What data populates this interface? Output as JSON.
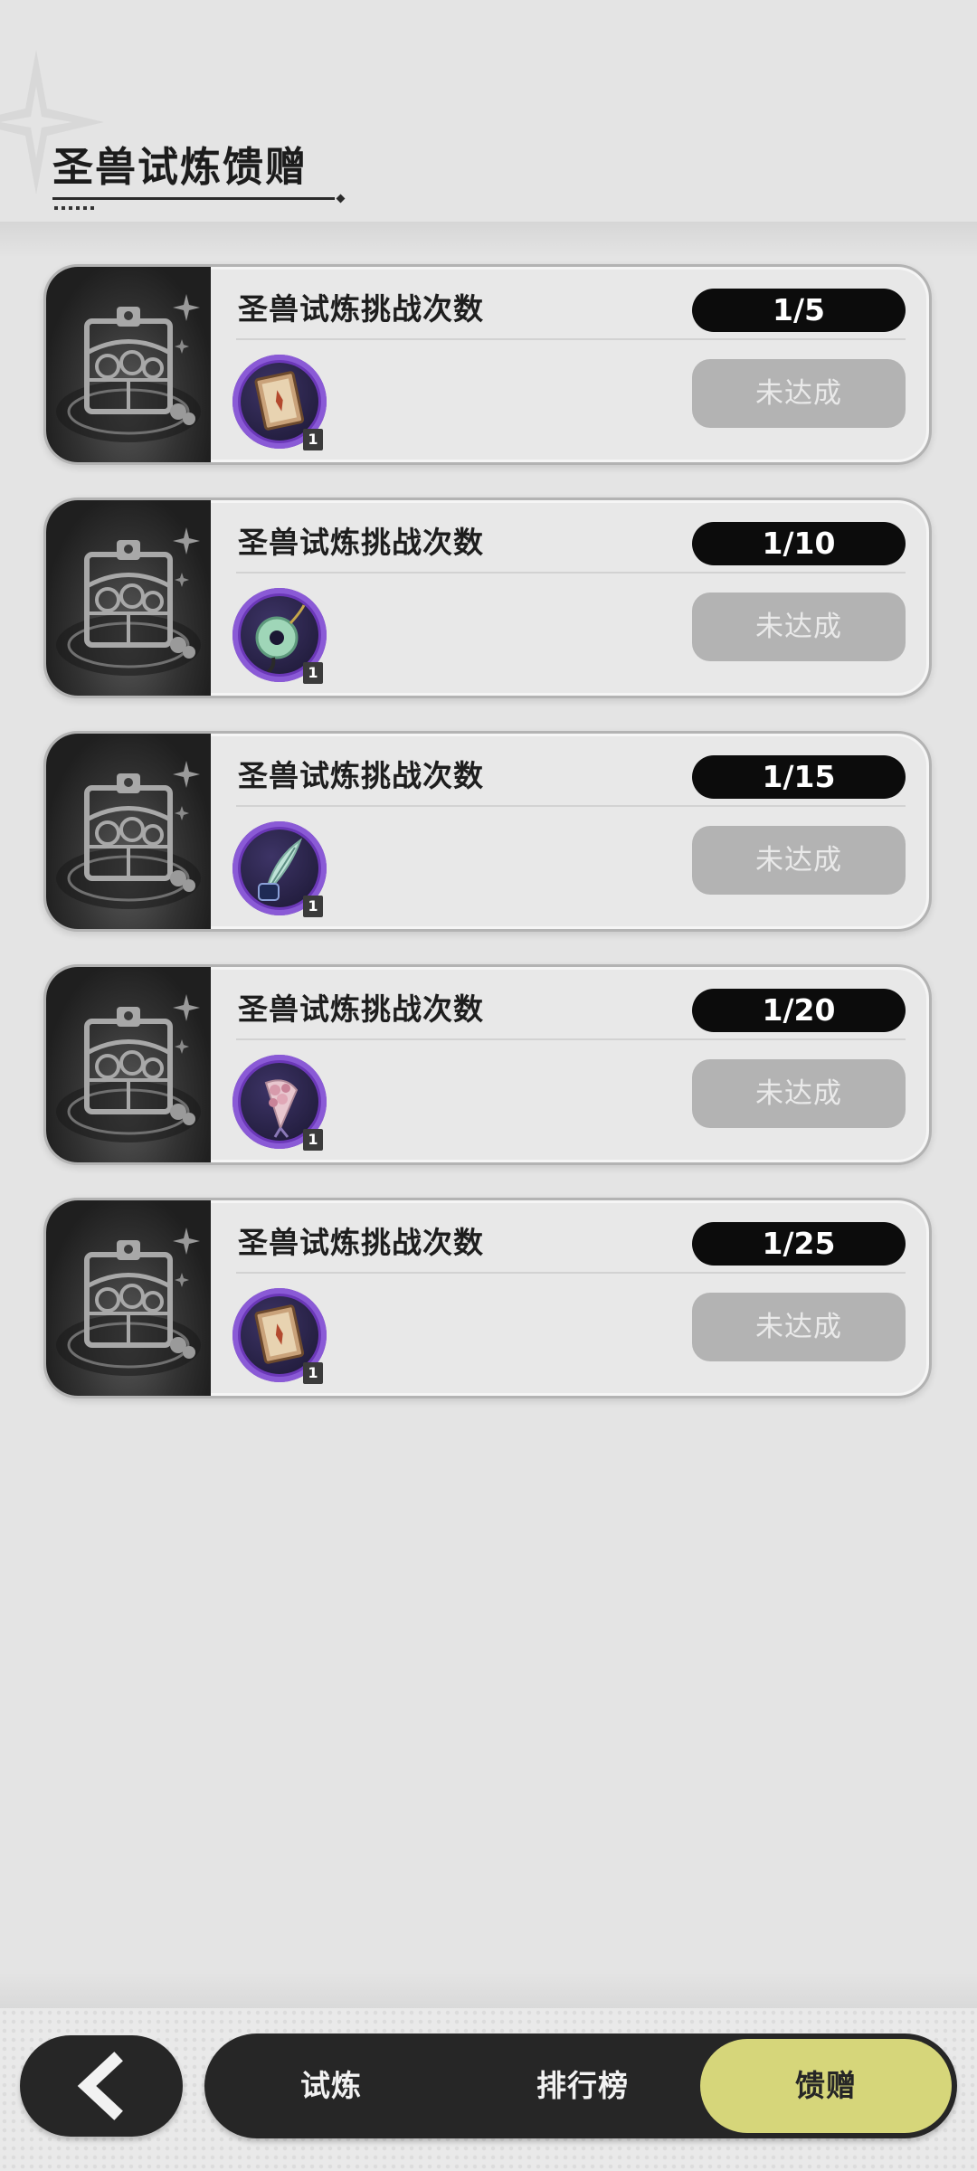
{
  "header": {
    "title": "圣兽试炼馈赠"
  },
  "tasks": [
    {
      "name": "圣兽试炼挑战次数",
      "progress": "1/5",
      "reward_icon": "book-icon",
      "reward_qty": "1",
      "status": "未达成"
    },
    {
      "name": "圣兽试炼挑战次数",
      "progress": "1/10",
      "reward_icon": "jade-pendant-icon",
      "reward_qty": "1",
      "status": "未达成"
    },
    {
      "name": "圣兽试炼挑战次数",
      "progress": "1/15",
      "reward_icon": "quill-ink-icon",
      "reward_qty": "1",
      "status": "未达成"
    },
    {
      "name": "圣兽试炼挑战次数",
      "progress": "1/20",
      "reward_icon": "flower-bouquet-icon",
      "reward_qty": "1",
      "status": "未达成"
    },
    {
      "name": "圣兽试炼挑战次数",
      "progress": "1/25",
      "reward_icon": "book-icon",
      "reward_qty": "1",
      "status": "未达成"
    }
  ],
  "nav": {
    "back_icon": "chevron-left-icon",
    "tabs": [
      {
        "label": "试炼"
      },
      {
        "label": "排行榜"
      },
      {
        "label": "馈赠",
        "active": true
      }
    ]
  },
  "colors": {
    "active_tab": "#d6d67a",
    "reward_frame": "#6b38b8",
    "status_disabled": "#b3b3b3"
  }
}
